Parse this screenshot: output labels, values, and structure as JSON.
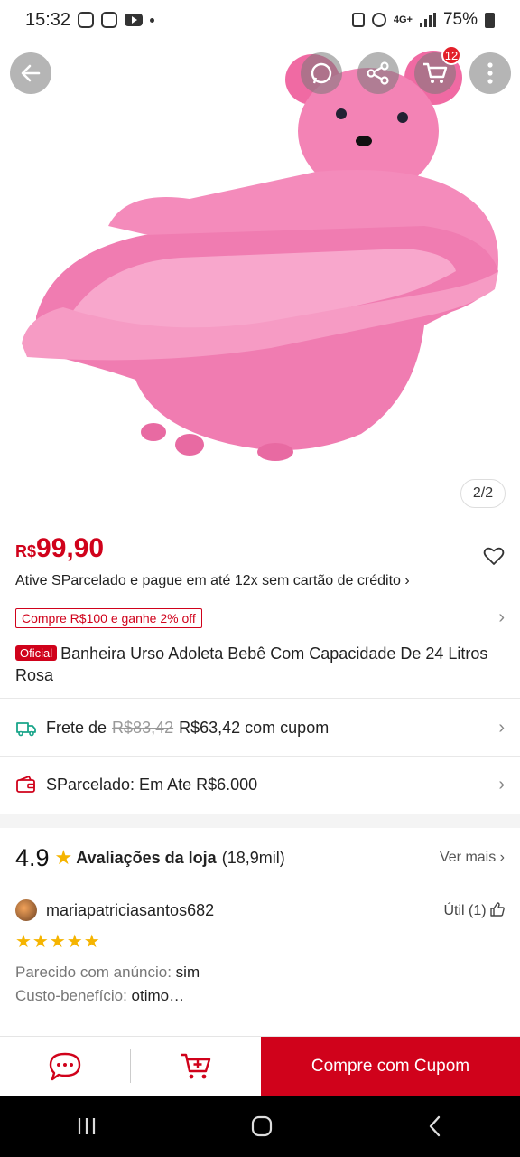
{
  "status_bar": {
    "time": "15:32",
    "network": "4G+",
    "battery": "75%"
  },
  "gallery": {
    "page_indicator": "2/2",
    "cart_count": "12",
    "icons": [
      "back-arrow-icon",
      "whatsapp-icon",
      "share-icon",
      "cart-icon",
      "more-vertical-icon"
    ]
  },
  "product": {
    "currency": "R$",
    "price": "99,90",
    "installment_text": "Ative SParcelado e pague em até 12x sem cartão de crédito ›",
    "coupon_tag": "Compre R$100 e ganhe 2% off",
    "official_badge": "Oficial",
    "title": "Banheira Urso Adoleta Bebê Com Capacidade De 24 Litros Rosa"
  },
  "shipping": {
    "label": "Frete de",
    "old_price": "R$83,42",
    "new_price": "R$63,42 com cupom"
  },
  "sparcelado": {
    "text": "SParcelado: Em Ate R$6.000"
  },
  "store_rating": {
    "score": "4.9",
    "label": "Avaliações da loja",
    "count": "(18,9mil)",
    "more": "Ver mais ›"
  },
  "review": {
    "user": "mariapatriciasantos682",
    "helpful": "Útil (1)",
    "stars": "★★★★★",
    "rating": 5,
    "line1_label": "Parecido com anúncio:",
    "line1_value": "sim",
    "line2_label": "Custo-benefício:",
    "line2_value": "otimo…"
  },
  "action_bar": {
    "buy_label": "Compre com Cupom"
  },
  "colors": {
    "accent": "#d0021b",
    "star": "#f5b400",
    "product_pink": "#f27fb0"
  }
}
